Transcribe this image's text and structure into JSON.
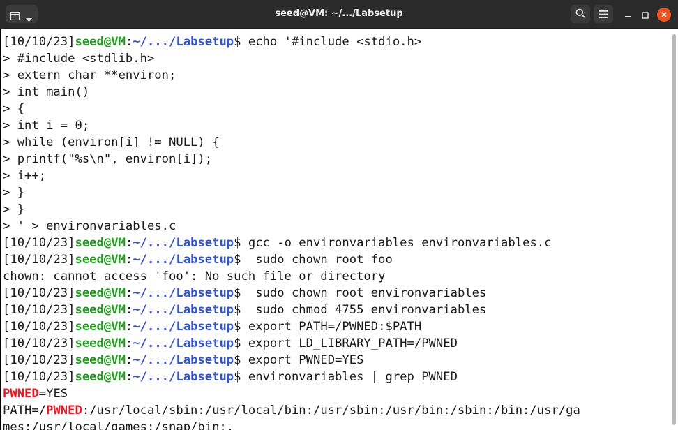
{
  "window": {
    "title": "seed@VM: ~/.../Labsetup",
    "terminal_icon": "terminal-icon",
    "menu_icon": "chevron-down-icon",
    "search_icon": "search-icon",
    "hamburger_icon": "hamburger-icon",
    "minimize_icon": "minimize-icon",
    "maximize_icon": "maximize-icon",
    "close_icon": "close-icon",
    "close_color": "#e95420"
  },
  "prompt": {
    "timestamp": "[10/10/23]",
    "user": "seed@VM",
    "colon": ":",
    "path": "~/.../Labsetup",
    "dollar": "$",
    "user_color": "#1fa01f",
    "path_color": "#3355cc"
  },
  "lines": {
    "l0_cmd": " echo '#include <stdio.h>",
    "l1": "> #include <stdlib.h>",
    "l2": "> extern char **environ;",
    "l3": "> int main()",
    "l4": "> {",
    "l5": "> int i = 0;",
    "l6": "> while (environ[i] != NULL) {",
    "l7": "> printf(\"%s\\n\", environ[i]);",
    "l8": "> i++;",
    "l9": "> }",
    "l10": "> }",
    "l11": "> ' > environvariables.c",
    "l12_cmd": " gcc -o environvariables environvariables.c",
    "l13_cmd": "  sudo chown root foo",
    "l14": "chown: cannot access 'foo': No such file or directory",
    "l15_cmd": "  sudo chown root environvariables",
    "l16_cmd": "  sudo chmod 4755 environvariables",
    "l17_cmd": " export PATH=/PWNED:$PATH",
    "l18_cmd": " export LD_LIBRARY_PATH=/PWNED",
    "l19_cmd": " export PWNED=YES",
    "l20_cmd": " environvariables | grep PWNED",
    "l21_hl": "PWNED",
    "l21_rest": "=YES",
    "l22_pre": "PATH=/",
    "l22_hl": "PWNED",
    "l22_rest": ":/usr/local/sbin:/usr/local/bin:/usr/sbin:/usr/bin:/sbin:/bin:/usr/ga",
    "l23": "mes:/usr/local/games:/snap/bin:."
  },
  "highlight_color": "#e01b24"
}
